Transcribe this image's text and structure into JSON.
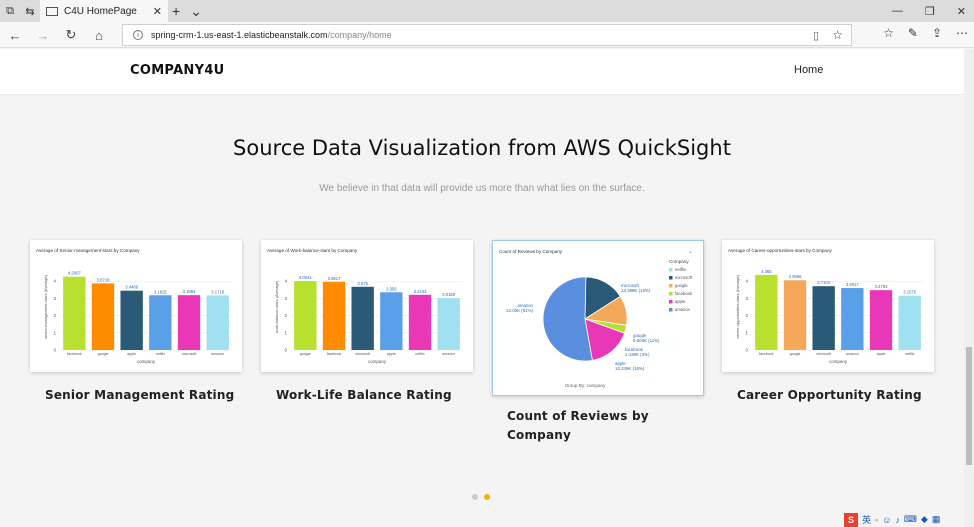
{
  "browser": {
    "tab_title": "C4U HomePage",
    "url_host": "spring-crm-1.us-east-1.elasticbeanstalk.com",
    "url_path": "/company/home"
  },
  "site": {
    "brand": "COMPANY4U",
    "nav_home": "Home",
    "title": "Source Data Visualization from AWS QuickSight",
    "subtitle": "We believe in that data will provide us more than what lies on the surface."
  },
  "cards": [
    {
      "title": "Senior Management Rating"
    },
    {
      "title": "Work-Life Balance Rating"
    },
    {
      "title": "Count of Reviews by Company"
    },
    {
      "title": "Career Opportunity Rating"
    }
  ],
  "chart_data": [
    {
      "type": "bar",
      "title": "Average of Senior-management-stars by Company",
      "xlabel": "company",
      "ylabel": "senior-management-stars (Average)",
      "categories": [
        "facebook",
        "google",
        "apple",
        "netflix",
        "microsoft",
        "amazon"
      ],
      "values": [
        4.2607,
        3.8718,
        3.4489,
        3.1825,
        3.1884,
        3.1718
      ],
      "value_labels": [
        "4.2607",
        "3.8718",
        "3.4489",
        "3.1825",
        "3.1884",
        "3.1718"
      ],
      "colors": [
        "#b8e02e",
        "#ff8c00",
        "#2a5a75",
        "#5aa0e8",
        "#e838b8",
        "#a0e0f0"
      ],
      "ylim": [
        0,
        5
      ],
      "yticks": [
        "0",
        "1",
        "2",
        "3",
        "4"
      ]
    },
    {
      "type": "bar",
      "title": "Average of Work-balance-stars by Company",
      "xlabel": "company",
      "ylabel": "work-balance-stars (Average)",
      "categories": [
        "google",
        "facebook",
        "microsoft",
        "apple",
        "netflix",
        "amazon"
      ],
      "values": [
        4.0041,
        3.9617,
        3.675,
        3.356,
        3.2103,
        3.0159
      ],
      "value_labels": [
        "4.0041",
        "3.9617",
        "3.675",
        "3.356",
        "3.2103",
        "3.0159"
      ],
      "colors": [
        "#b8e02e",
        "#ff8c00",
        "#2a5a75",
        "#5aa0e8",
        "#e838b8",
        "#a0e0f0"
      ],
      "ylim": [
        0,
        5
      ],
      "yticks": [
        "0",
        "1",
        "2",
        "3",
        "4"
      ]
    },
    {
      "type": "pie",
      "title": "Count of Reviews by Company",
      "legend_title": "Company",
      "legend": [
        "netflix",
        "microsoft",
        "google",
        "facebook",
        "apple",
        "amazon"
      ],
      "slices": [
        {
          "name": "microsoft",
          "label": "13.398K (15%)",
          "value": 15,
          "color": "#2a5a75"
        },
        {
          "name": "google",
          "label": "9.604K (11%)",
          "value": 11,
          "color": "#f5a85a"
        },
        {
          "name": "facebook",
          "label": "1.438K (3%)",
          "value": 3,
          "color": "#b8e02e"
        },
        {
          "name": "apple",
          "label": "10.249K (16%)",
          "value": 16,
          "color": "#e838b8"
        },
        {
          "name": "amazon",
          "label": "22.00K (51%)",
          "value": 51,
          "color": "#5a8fe0"
        }
      ],
      "footer": "Group By: company"
    },
    {
      "type": "bar",
      "title": "Average of Career-opportunities-stars by Company",
      "xlabel": "company",
      "ylabel": "career-opportunities-stars (Average)",
      "categories": [
        "facebook",
        "google",
        "microsoft",
        "amazon",
        "apple",
        "netflix"
      ],
      "values": [
        4.365,
        4.0566,
        3.7102,
        3.6017,
        3.4793,
        3.1575
      ],
      "value_labels": [
        "4.365",
        "4.0566",
        "3.7102",
        "3.6017",
        "3.4793",
        "3.1575"
      ],
      "colors": [
        "#b8e02e",
        "#f5a85a",
        "#2a5a75",
        "#5aa0e8",
        "#e838b8",
        "#a0e0f0"
      ],
      "ylim": [
        0,
        5
      ],
      "yticks": [
        "0",
        "1",
        "2",
        "3",
        "4"
      ]
    }
  ],
  "carousel": {
    "active_index": 1,
    "count": 2
  },
  "tray": {
    "ime": "英"
  }
}
